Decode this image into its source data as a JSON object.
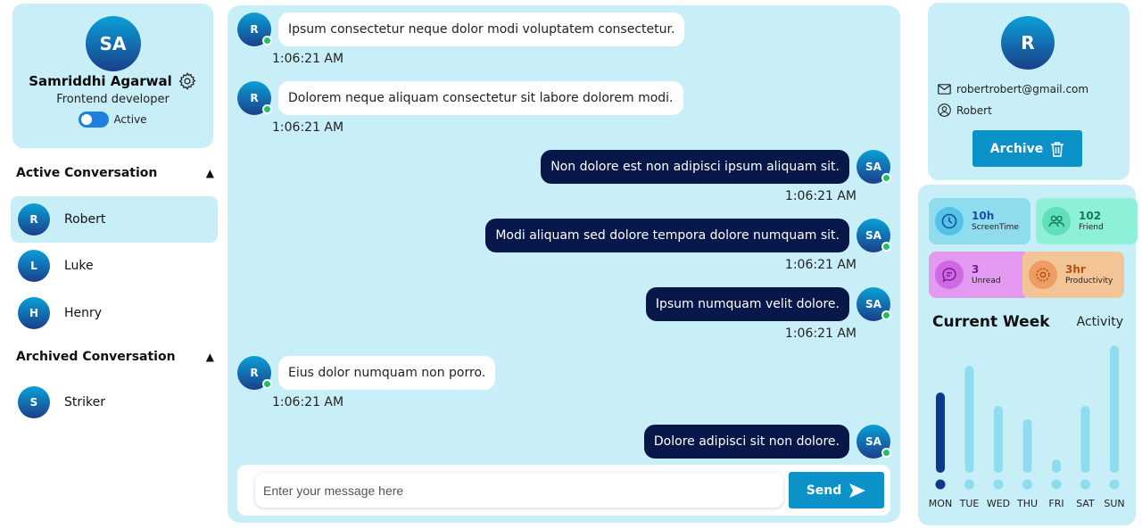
{
  "profile": {
    "initials": "SA",
    "name": "Samriddhi Agarwal",
    "role": "Frontend developer",
    "status_label": "Active",
    "status_on": true
  },
  "sections": {
    "active_title": "Active Conversation",
    "archived_title": "Archived Conversation"
  },
  "active_conversations": [
    {
      "initial": "R",
      "name": "Robert",
      "selected": true
    },
    {
      "initial": "L",
      "name": "Luke",
      "selected": false
    },
    {
      "initial": "H",
      "name": "Henry",
      "selected": false
    }
  ],
  "archived_conversations": [
    {
      "initial": "S",
      "name": "Striker"
    }
  ],
  "messages": [
    {
      "from": "R",
      "direction": "in",
      "text": "Ipsum consectetur neque dolor modi voluptatem consectetur.",
      "time": "1:06:21 AM"
    },
    {
      "from": "R",
      "direction": "in",
      "text": "Dolorem neque aliquam consectetur sit labore dolorem modi.",
      "time": "1:06:21 AM"
    },
    {
      "from": "SA",
      "direction": "out",
      "text": "Non dolore est non adipisci ipsum aliquam sit.",
      "time": "1:06:21 AM"
    },
    {
      "from": "SA",
      "direction": "out",
      "text": "Modi aliquam sed dolore tempora dolore numquam sit.",
      "time": "1:06:21 AM"
    },
    {
      "from": "SA",
      "direction": "out",
      "text": "Ipsum numquam velit dolore.",
      "time": "1:06:21 AM"
    },
    {
      "from": "R",
      "direction": "in",
      "text": "Eius dolor numquam non porro.",
      "time": "1:06:21 AM"
    },
    {
      "from": "SA",
      "direction": "out",
      "text": "Dolore adipisci sit non dolore.",
      "time": ""
    }
  ],
  "composer": {
    "placeholder": "Enter your message here",
    "send_label": "Send"
  },
  "contact": {
    "initial": "R",
    "email": "robertrobert@gmail.com",
    "username": "Robert",
    "archive_label": "Archive"
  },
  "stats": [
    {
      "value": "10h",
      "label": "ScreenTime",
      "icon": "clock-icon",
      "bg": "#8fdcef",
      "icon_bg": "#55c3e6",
      "value_color": "#1a4fa0"
    },
    {
      "value": "102",
      "label": "Friend",
      "icon": "people-icon",
      "bg": "#8ff0d8",
      "icon_bg": "#5fe0b8",
      "value_color": "#137a52"
    },
    {
      "value": "3",
      "label": "Unread",
      "icon": "chat-bubble-icon",
      "bg": "#e39af0",
      "icon_bg": "#cf68e3",
      "value_color": "#7a1a9a"
    },
    {
      "value": "3hr",
      "label": "Productivity",
      "icon": "gear-badge-icon",
      "bg": "#f3c596",
      "icon_bg": "#ee9d62",
      "value_color": "#b4500e"
    }
  ],
  "week": {
    "title": "Current Week",
    "subtitle": "Activity"
  },
  "chart_data": {
    "type": "bar",
    "categories": [
      "MON",
      "TUE",
      "WED",
      "THU",
      "FRI",
      "SAT",
      "SUN"
    ],
    "values": [
      60,
      80,
      50,
      40,
      10,
      50,
      95
    ],
    "highlight_index": 0,
    "colors": {
      "highlight": "#0a3a8c",
      "normal": "#8fdcef"
    }
  }
}
